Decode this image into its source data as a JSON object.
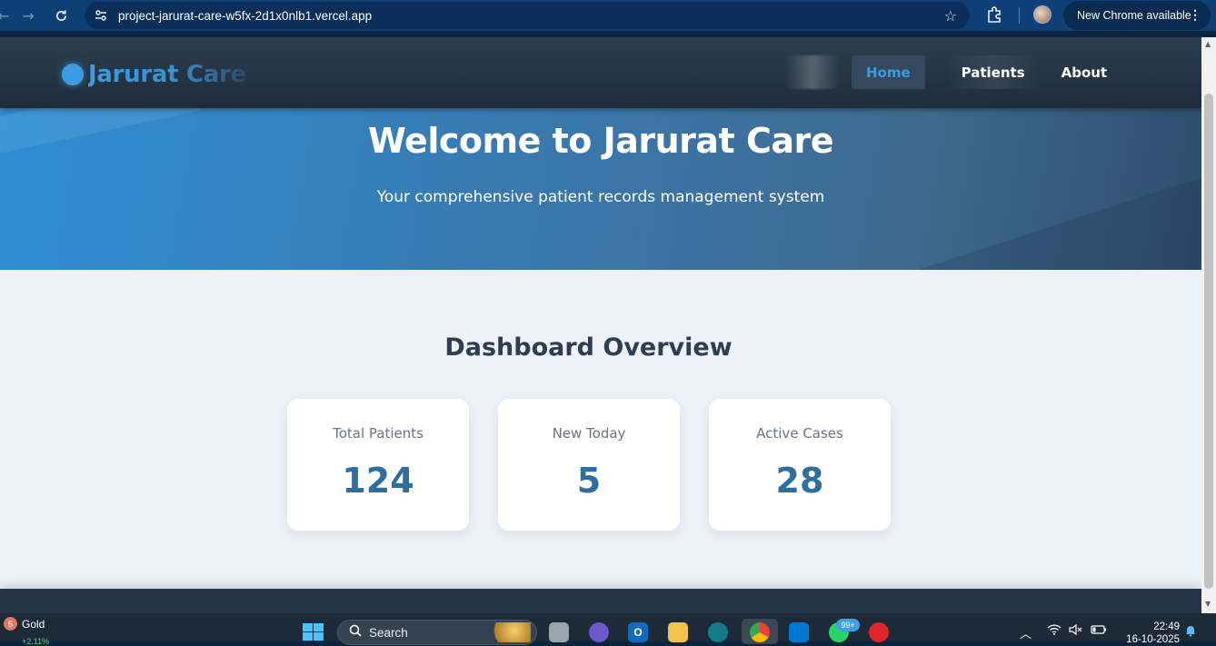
{
  "browser": {
    "url": "project-jarurat-care-w5fx-2d1x0nlb1.vercel.app",
    "update_label": "New Chrome available"
  },
  "header": {
    "brand": "Jarurat Care",
    "nav": [
      {
        "label": "Home",
        "active": true
      },
      {
        "label": "Patients",
        "active": false
      },
      {
        "label": "About",
        "active": false
      }
    ]
  },
  "hero": {
    "title": "Welcome to Jarurat Care",
    "subtitle": "Your comprehensive patient records management system"
  },
  "dashboard": {
    "title": "Dashboard Overview",
    "cards": [
      {
        "label": "Total Patients",
        "value": "124"
      },
      {
        "label": "New Today",
        "value": "5"
      },
      {
        "label": "Active Cases",
        "value": "28"
      }
    ]
  },
  "taskbar": {
    "weather_badge": "5",
    "ticker_label": "Gold",
    "ticker_change": "+2.11%",
    "search_label": "Search",
    "whatsapp_badge": "99+",
    "time": "22:49",
    "date": "16-10-2025"
  },
  "colors": {
    "accent": "#3b9be0",
    "header_bg": "#2c3e50",
    "card_value": "#2e6fa0"
  }
}
